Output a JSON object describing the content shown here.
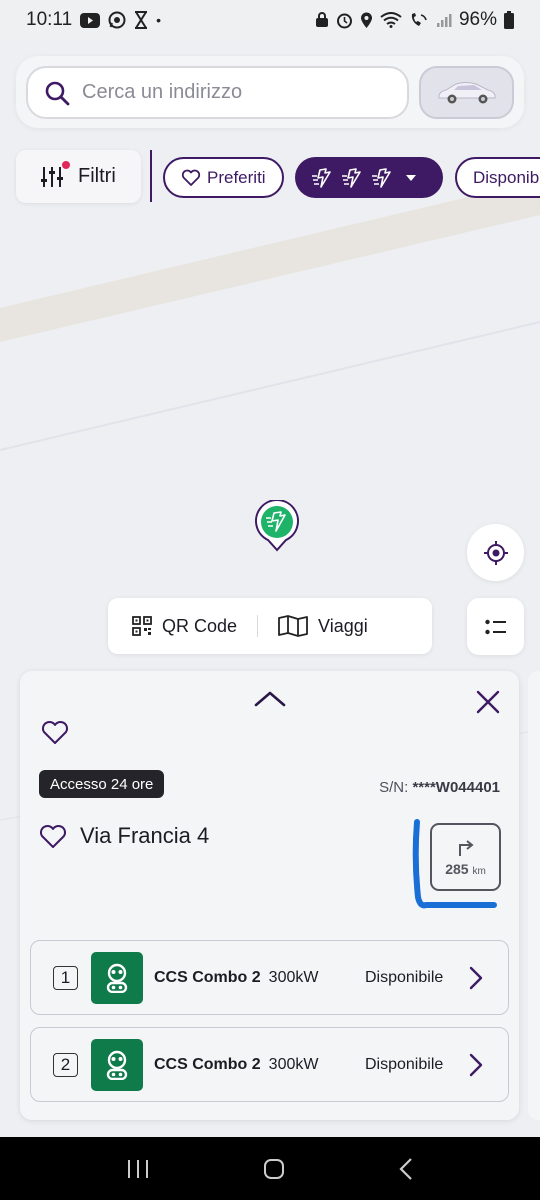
{
  "status_bar": {
    "time": "10:11",
    "battery": "96%"
  },
  "search": {
    "placeholder": "Cerca un indirizzo"
  },
  "filters": {
    "filters_label": "Filtri",
    "favorites_label": "Preferiti",
    "available_label": "Disponibi"
  },
  "actions": {
    "qr_label": "QR Code",
    "trips_label": "Viaggi"
  },
  "station": {
    "access": "Accesso 24 ore",
    "sn_prefix": "S/N: ",
    "sn_value": "****W044401",
    "street": "Via Francia 4",
    "distance": "285",
    "distance_unit": "km",
    "connectors": [
      {
        "number": "1",
        "type": "CCS Combo 2",
        "power": "300kW",
        "status": "Disponibile"
      },
      {
        "number": "2",
        "type": "CCS Combo 2",
        "power": "300kW",
        "status": "Disponibile"
      }
    ]
  },
  "colors": {
    "brand_purple": "#3d1a63",
    "available_green": "#0f7a4a",
    "pin_green": "#1fb36a",
    "annotation_blue": "#1a6fd6"
  }
}
